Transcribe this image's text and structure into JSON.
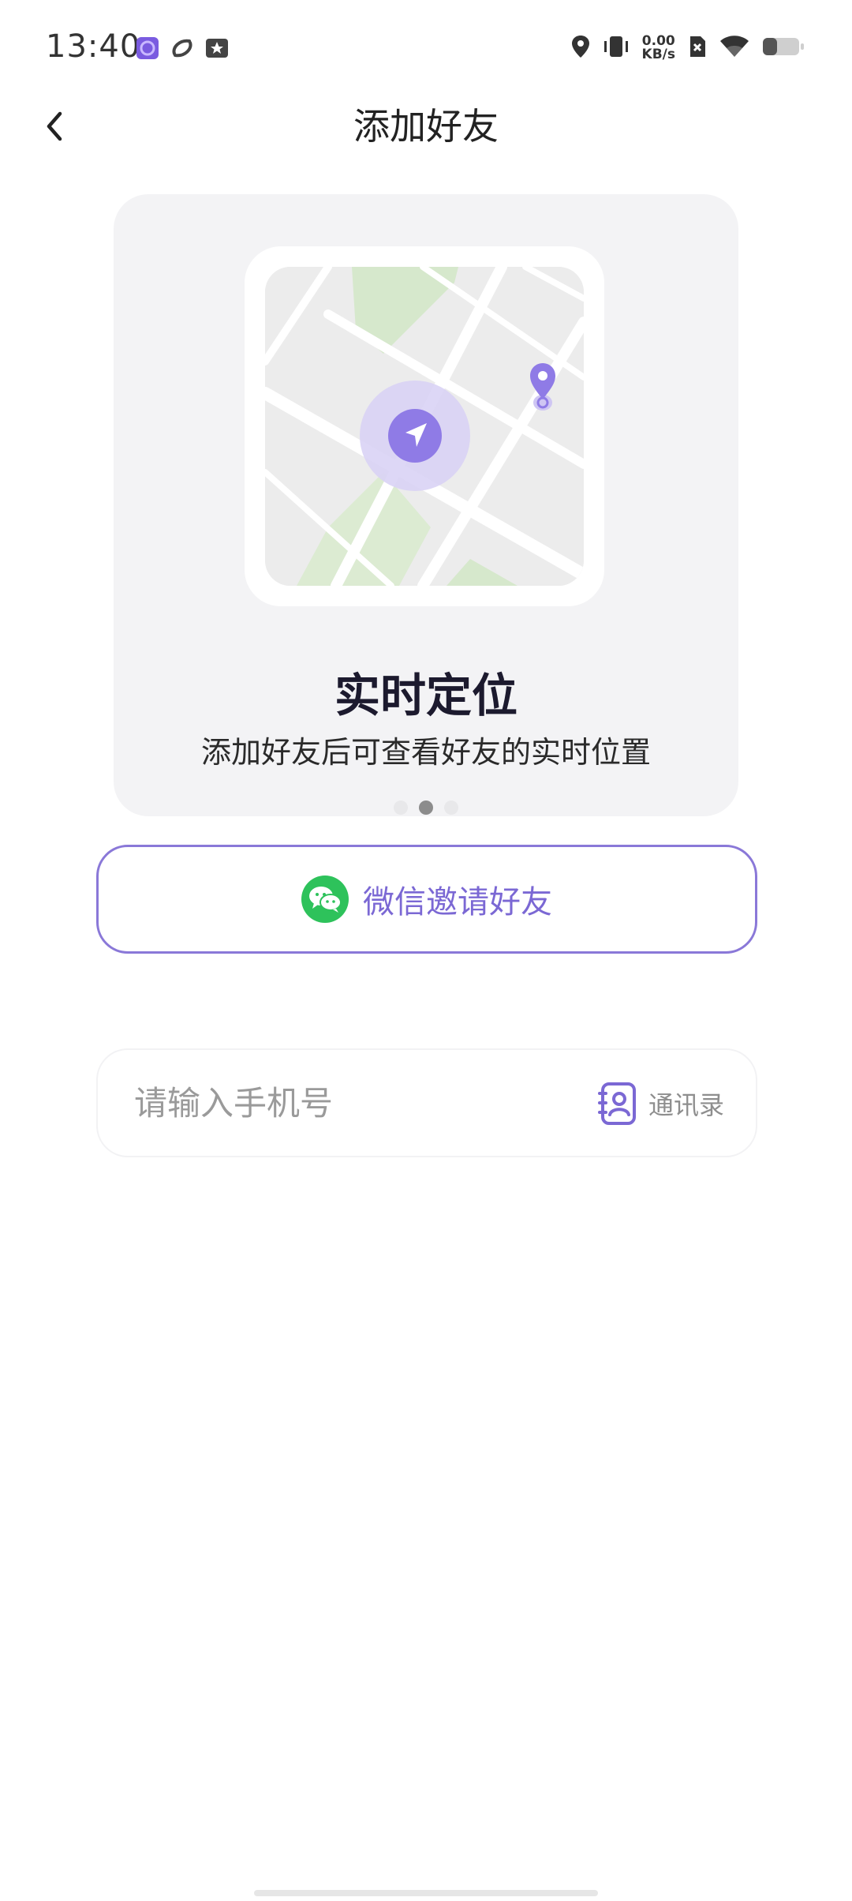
{
  "status_bar": {
    "time": "13:40",
    "net_speed_value": "0.00",
    "net_speed_unit": "KB/s",
    "left_icons": [
      "app-notification-icon",
      "sync-icon",
      "star-notification-icon"
    ],
    "right_icons": [
      "location-icon",
      "vibrate-icon",
      "no-sim-icon",
      "wifi-icon",
      "battery-icon"
    ]
  },
  "header": {
    "title": "添加好友",
    "back_icon": "chevron-left-icon"
  },
  "carousel": {
    "slide_title": "实时定位",
    "slide_description": "添加好友后可查看好友的实时位置",
    "page_count": 3,
    "active_index": 1
  },
  "invite": {
    "label": "微信邀请好友",
    "icon": "wechat-icon"
  },
  "phone": {
    "placeholder": "请输入手机号",
    "value": "",
    "contacts_label": "通讯录",
    "contacts_icon": "contacts-book-icon"
  },
  "colors": {
    "accent": "#7b68d4",
    "wechat_green": "#2ec25b",
    "card_bg": "#f3f3f5"
  }
}
